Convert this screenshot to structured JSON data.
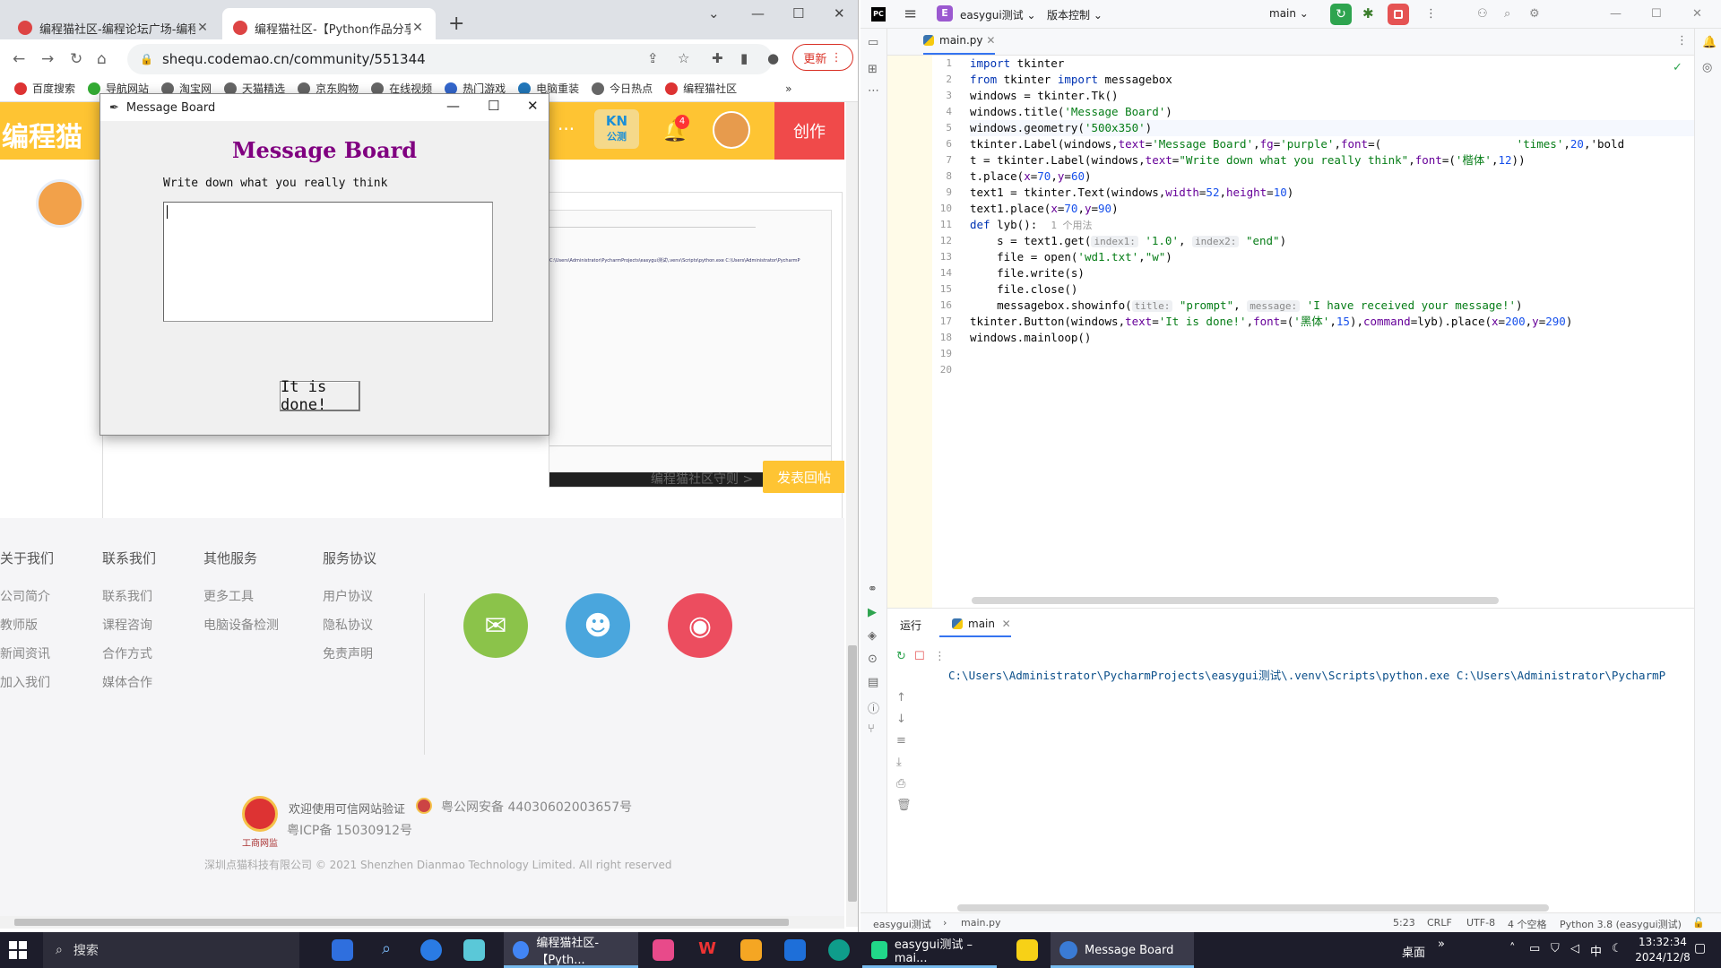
{
  "chrome": {
    "tabs": [
      {
        "title": "编程猫社区-编程论坛广场-编程"
      },
      {
        "title": "编程猫社区-【Python作品分享】"
      }
    ],
    "new_tab": "+",
    "url": "shequ.codemao.cn/community/551344",
    "update_label": "更新",
    "bookmarks": [
      "百度搜索",
      "导航网站",
      "淘宝网",
      "天猫精选",
      "京东购物",
      "在线视频",
      "热门游戏",
      "电脑重装",
      "今日热点",
      "编程猫社区"
    ],
    "more_bookmarks": "»"
  },
  "site": {
    "logo_text": "编程猫",
    "more": "···",
    "kn_label": "KN",
    "kn_sub": "公测",
    "notif_count": "4",
    "create_label": "创作",
    "rule_link": "编程猫社区守则 >",
    "reply_label": "发表回帖",
    "embed_cmd": "C:\\Users\\Administrator\\PycharmProjects\\easygui测试\\.venv\\Scripts\\python.exe C:\\Users\\Administrator\\PycharmP"
  },
  "footer": {
    "columns": [
      {
        "head": "关于我们",
        "items": [
          "公司简介",
          "教师版",
          "新闻资讯",
          "加入我们"
        ]
      },
      {
        "head": "联系我们",
        "items": [
          "联系我们",
          "课程咨询",
          "合作方式",
          "媒体合作"
        ]
      },
      {
        "head": "其他服务",
        "items": [
          "更多工具",
          "电脑设备检测"
        ]
      },
      {
        "head": "服务协议",
        "items": [
          "用户协议",
          "隐私协议",
          "免责声明"
        ]
      }
    ],
    "trust_text": "欢迎使用可信网站验证",
    "icp": "粤ICP备 15030912号",
    "police": "粤公网安备 44030602003657号",
    "gongshang": "工商网监",
    "copyright": "深圳点猫科技有限公司    © 2021 Shenzhen Dianmao Technology Limited. All right reserved",
    "social": [
      {
        "icon": "wechat-icon",
        "color": "#8bc34a"
      },
      {
        "icon": "qq-icon",
        "color": "#4aa6dd"
      },
      {
        "icon": "weibo-icon",
        "color": "#ec4d5f"
      }
    ]
  },
  "tk": {
    "window_title": "Message Board",
    "heading": "Message Board",
    "heading_color": "#800080",
    "prompt": "Write down what you really think",
    "button_label": "It is done!"
  },
  "pycharm": {
    "project_initial": "E",
    "project": "easygui测试 ⌄",
    "vcs": "版本控制 ⌄",
    "branch": "main ⌄",
    "file_tab": "main.py",
    "line_numbers": [
      "1",
      "2",
      "3",
      "4",
      "5",
      "6",
      "7",
      "8",
      "9",
      "10",
      "11",
      "12",
      "13",
      "14",
      "15",
      "16",
      "17",
      "18",
      "19",
      "20"
    ],
    "code": [
      "import tkinter",
      "from tkinter import messagebox",
      "windows = tkinter.Tk()",
      "windows.title('Message Board')",
      "windows.geometry('500x350')",
      "tkinter.Label(windows,text='Message Board',fg='purple',font=(                    'times',20,'bold",
      "t = tkinter.Label(windows,text=\"Write down what you really think\",font=('楷体',12))",
      "t.place(x=70,y=60)",
      "text1 = tkinter.Text(windows,width=52,height=10)",
      "text1.place(x=70,y=90)",
      "def lyb():",
      "    s = text1.get(",
      "    file = open('wd1.txt',\"w\")",
      "    file.write(s)",
      "    file.close()",
      "    messagebox.showinfo(",
      "tkinter.Button(windows,text='It is done!',font=('黑体',15),command=lyb).place(x=200,y=290)",
      "windows.mainloop()",
      "",
      ""
    ],
    "usage_hint": "1 个用法",
    "hint_index1": "index1:",
    "hint_index2": "index2:",
    "hint_title": "title:",
    "hint_message": "message:",
    "run_label": "运行",
    "run_tab": "main",
    "run_output": "C:\\Users\\Administrator\\PycharmProjects\\easygui测试\\.venv\\Scripts\\python.exe C:\\Users\\Administrator\\PycharmP",
    "status": {
      "project": "easygui测试",
      "file": "main.py",
      "position": "5:23",
      "line_sep": "CRLF",
      "encoding": "UTF-8",
      "indent": "4 个空格",
      "interpreter": "Python 3.8 (easygui测试)"
    }
  },
  "taskbar": {
    "search": "搜索",
    "windows": [
      {
        "title": "编程猫社区-【Pyth...",
        "color": "#4285f4"
      },
      {
        "title": "easygui测试 – mai...",
        "color": "#21d789"
      },
      {
        "title": "Message Board",
        "color": "#3a7bd5"
      }
    ],
    "desktop": "桌面",
    "ime": "中",
    "time": "13:32:34",
    "date": "2024/12/8"
  }
}
